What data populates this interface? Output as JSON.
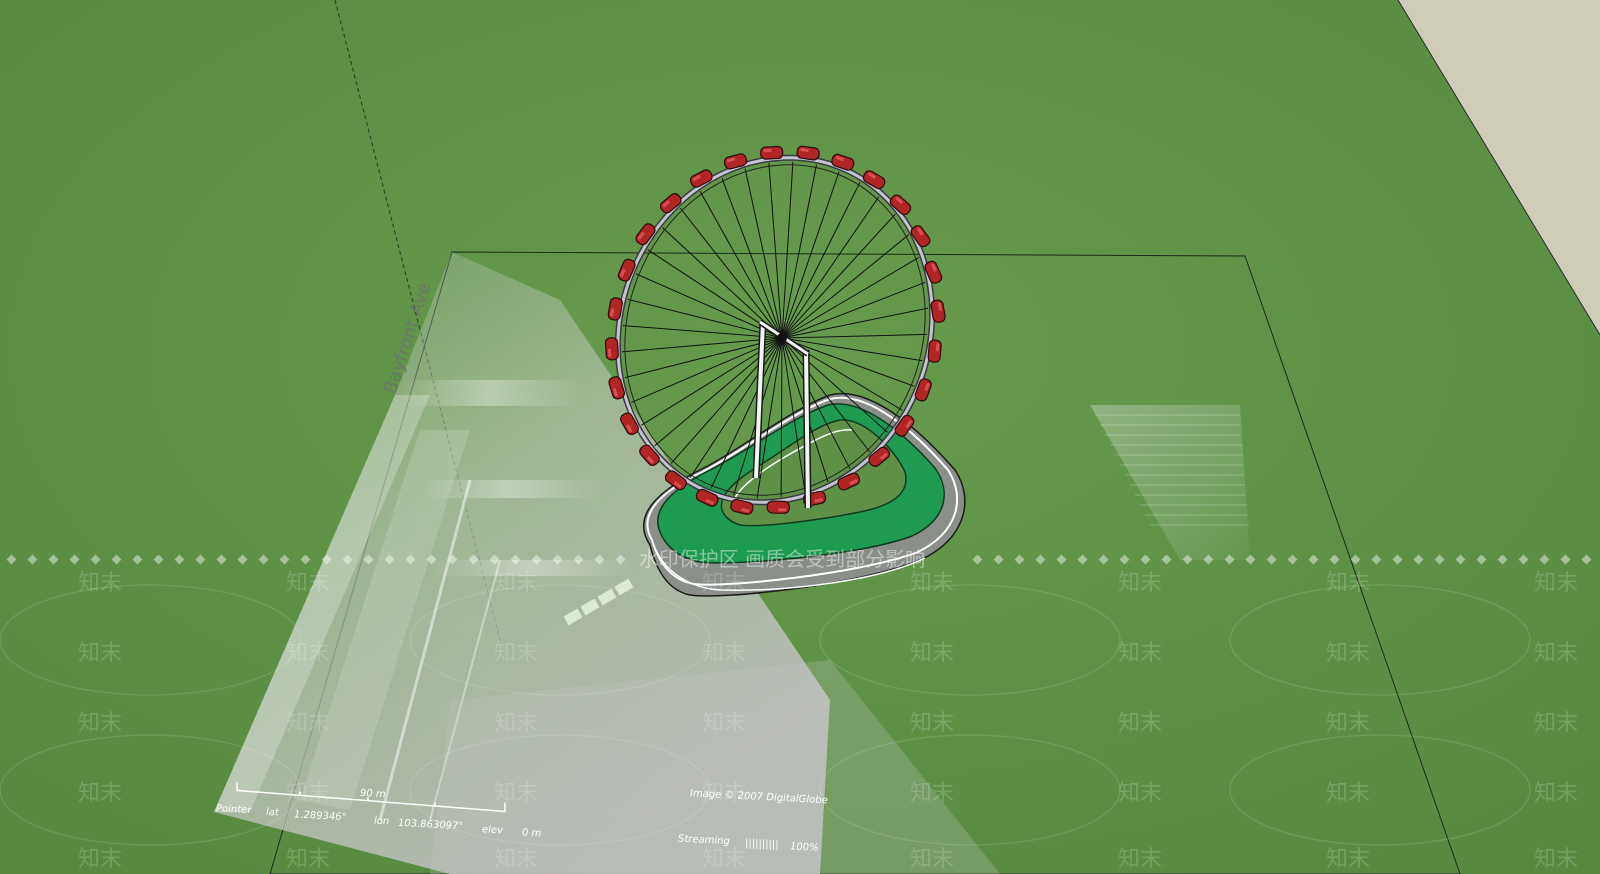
{
  "colors": {
    "ground": "#5e9145",
    "far_plane": "#cfccb8",
    "wheel_rim": "#b8b8c4",
    "cabin": "#b22525",
    "platform_green": "#1f9a52",
    "track_gray": "#8a8f8a",
    "support": "#f4f4f4"
  },
  "imagery": {
    "scale_label": "90 m",
    "copyright": "Image © 2007 DigitalGlobe",
    "pointer_label": "Pointer",
    "lat_label": "lat",
    "lat_value": "1.289346°",
    "lon_label": "lon",
    "lon_value": "103.863097°",
    "elev_label": "elev",
    "elev_value": "0 m",
    "streaming_label": "Streaming",
    "streaming_bar": "||||||||||",
    "streaming_value": "100%",
    "road_label": "Bayfront Ave"
  },
  "watermark": {
    "banner": "水印保护区  画质会受到部分影响",
    "tile": "知末"
  },
  "model": {
    "cabin_count": 28,
    "spoke_count": 40
  }
}
